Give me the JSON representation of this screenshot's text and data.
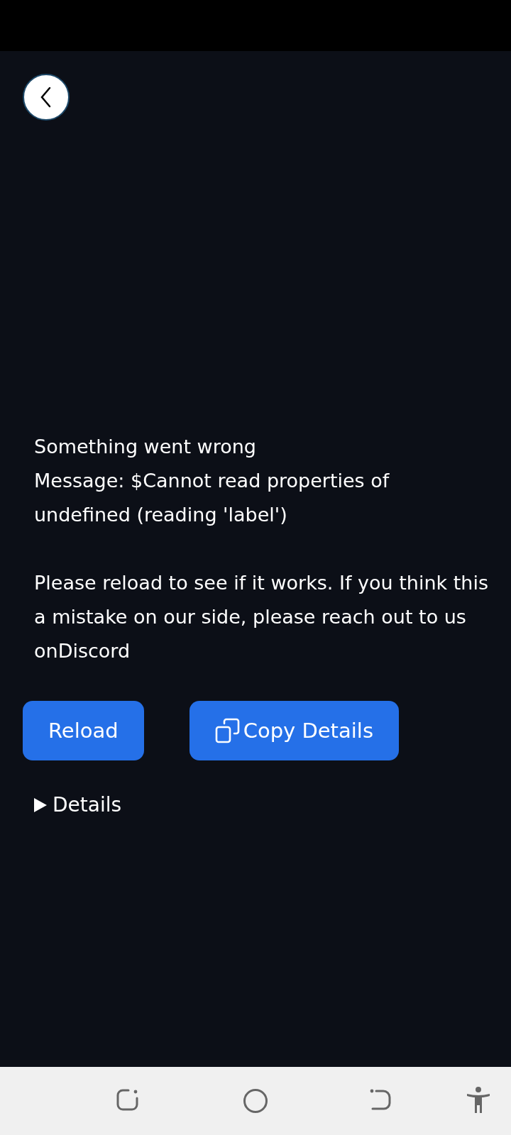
{
  "error": {
    "title": "Something went wrong",
    "message": "Message: $Cannot read properties of undefined (reading 'label')",
    "help": "Please reload to see if it works. If you think this a mistake on our side, please reach out to us onDiscord"
  },
  "buttons": [
    {
      "label": "Reload",
      "kind": "plain"
    },
    {
      "label": "Copy Details",
      "kind": "copy"
    }
  ],
  "details": {
    "label": "Details",
    "expanded": false
  }
}
